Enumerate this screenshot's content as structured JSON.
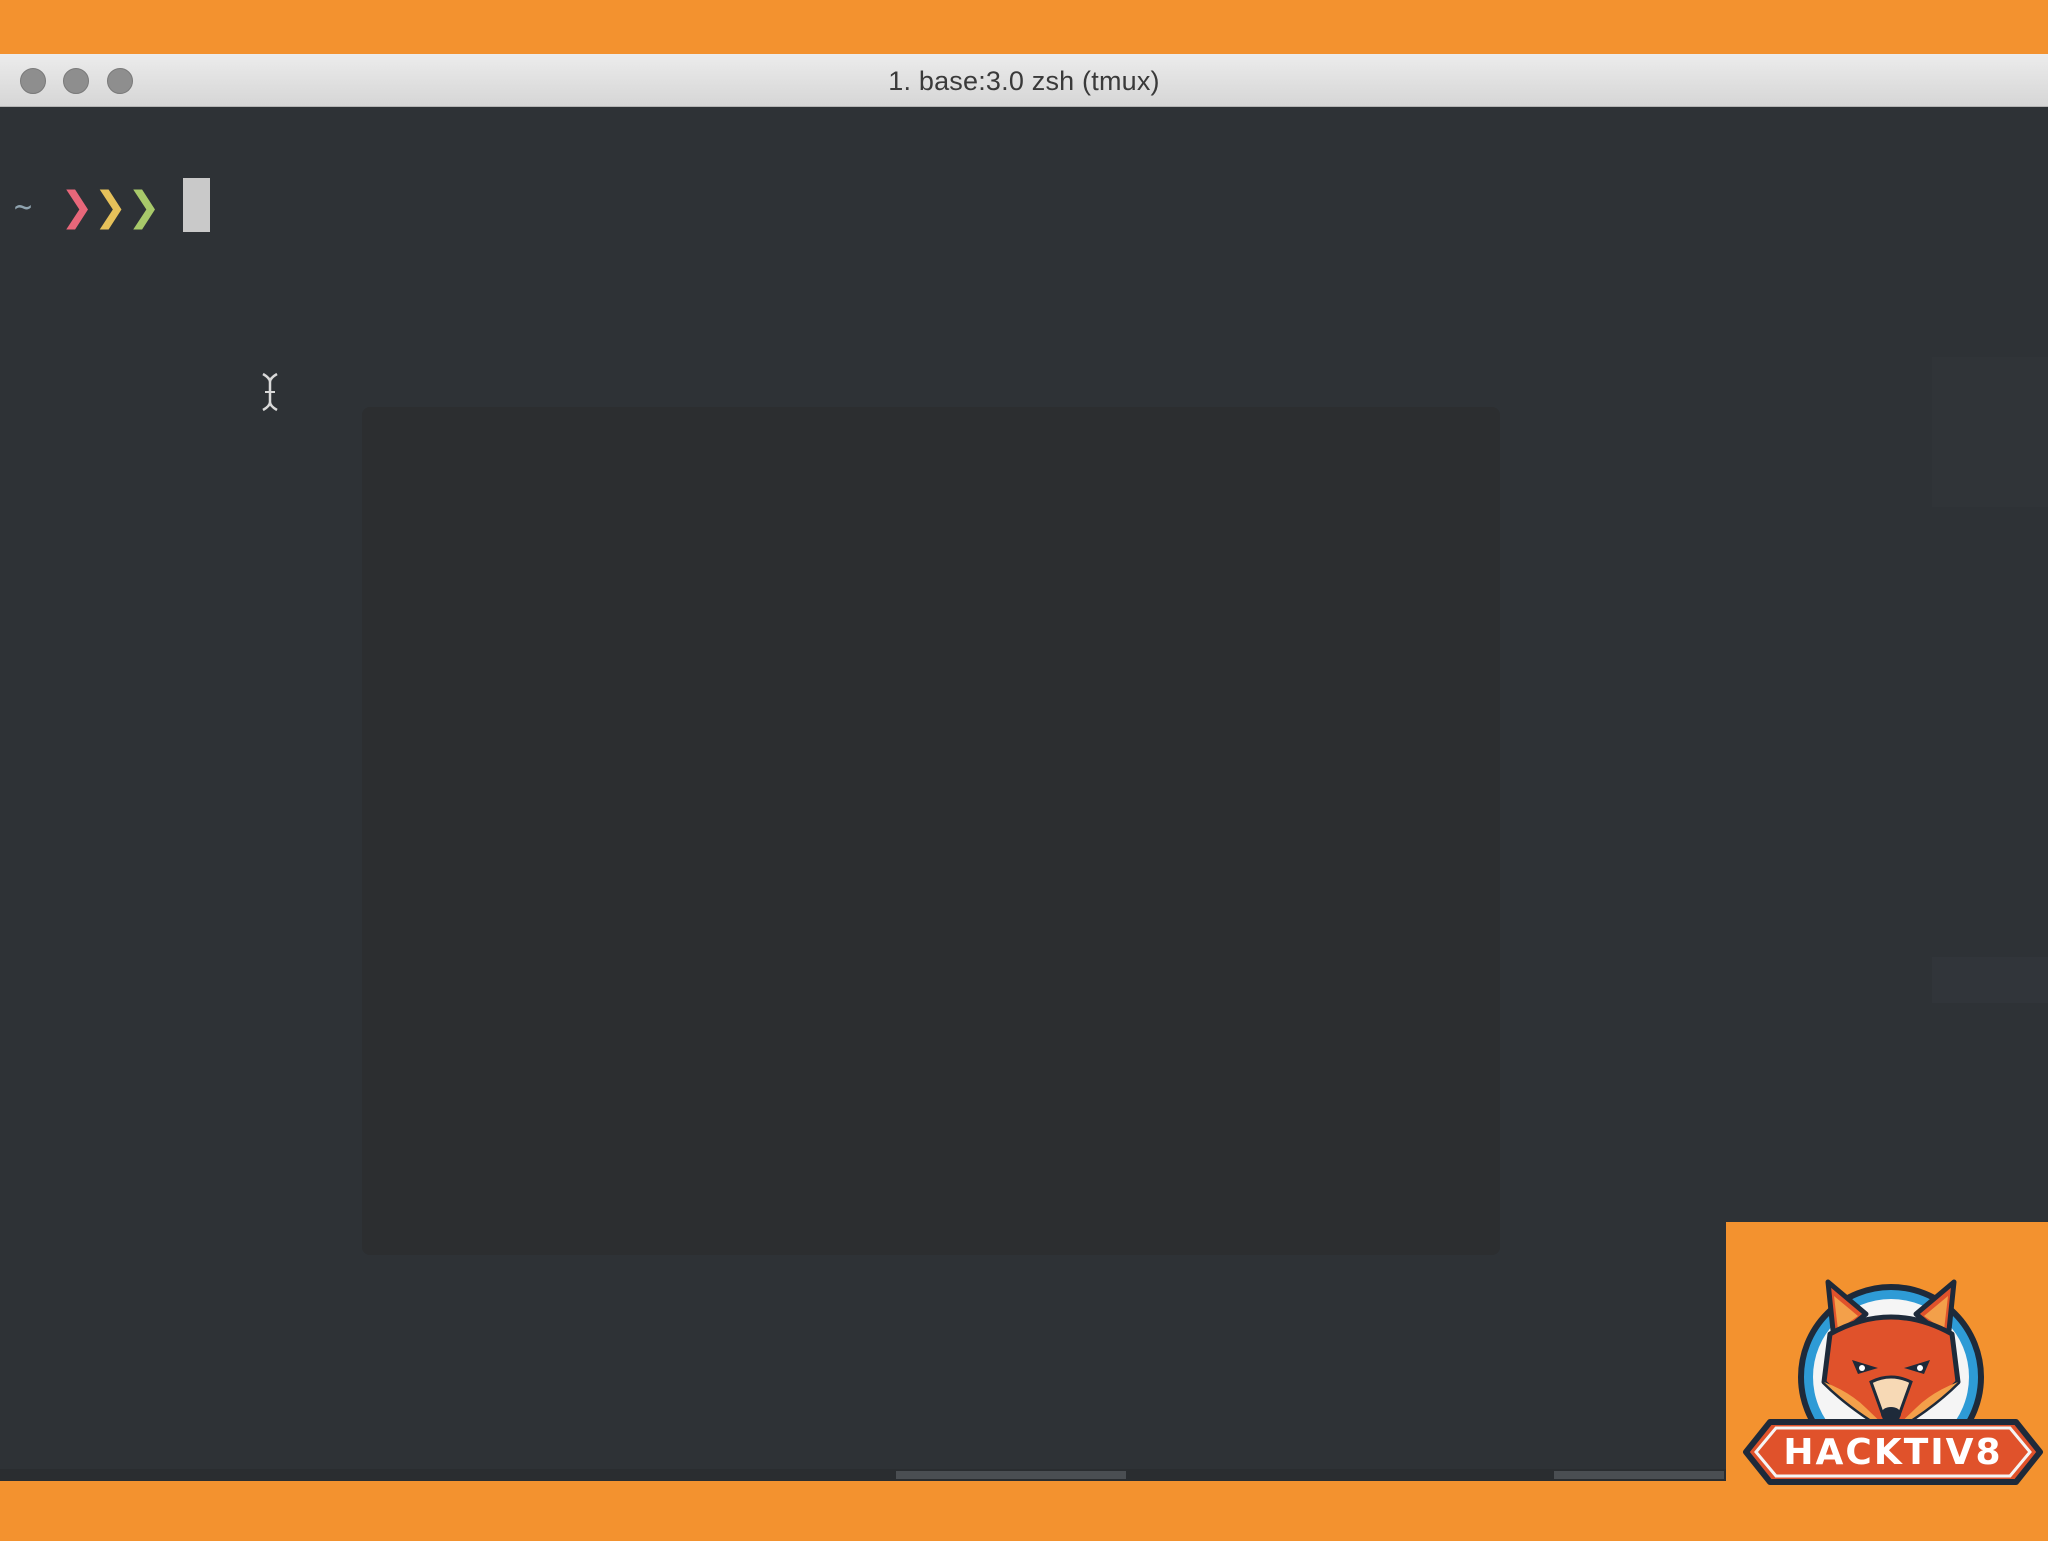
{
  "window": {
    "title": "1. base:3.0 zsh (tmux)"
  },
  "terminal": {
    "prompt_symbol": "~",
    "prompt_chevrons": [
      {
        "glyph": "❯",
        "color": "#E8677A"
      },
      {
        "glyph": "❯",
        "color": "#E6C15A"
      },
      {
        "glyph": "❯",
        "color": "#A8C96A"
      }
    ]
  },
  "logo": {
    "text": "HACKTIV8"
  },
  "colors": {
    "frame": "#F3922F",
    "terminal_bg": "#2E3236"
  }
}
